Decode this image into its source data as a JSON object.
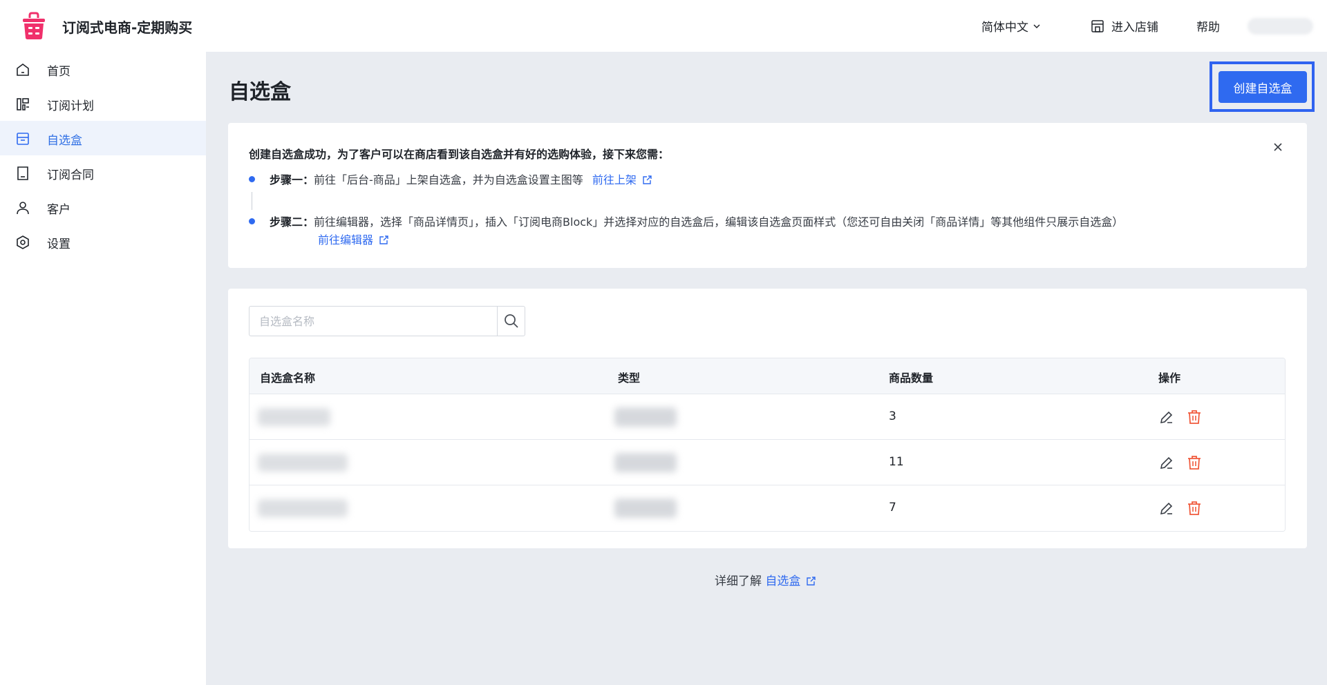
{
  "header": {
    "app_title": "订阅式电商-定期购买",
    "language": "简体中文",
    "enter_store": "进入店铺",
    "help": "帮助",
    "icons": {
      "logo": "basket-logo-icon",
      "lang": "chevron-down-icon",
      "store": "store-icon"
    }
  },
  "sidebar": {
    "items": [
      {
        "label": "首页",
        "icon": "home-icon",
        "active": false
      },
      {
        "label": "订阅计划",
        "icon": "layout-icon",
        "active": false
      },
      {
        "label": "自选盒",
        "icon": "box-icon",
        "active": true
      },
      {
        "label": "订阅合同",
        "icon": "document-icon",
        "active": false
      },
      {
        "label": "客户",
        "icon": "user-icon",
        "active": false
      },
      {
        "label": "设置",
        "icon": "settings-hexagon-icon",
        "active": false
      }
    ]
  },
  "page": {
    "title": "自选盒",
    "create_button": "创建自选盒"
  },
  "notice": {
    "title": "创建自选盒成功，为了客户可以在商店看到该自选盒并有好的选购体验，接下来您需：",
    "step1_prefix": "步骤一：",
    "step1_text": "前往「后台-商品」上架自选盒，并为自选盒设置主图等",
    "step1_link": "前往上架",
    "step2_prefix": "步骤二：",
    "step2_text": "前往编辑器，选择「商品详情页」，插入「订阅电商Block」并选择对应的自选盒后，编辑该自选盒页面样式（您还可自由关闭「商品详情」等其他组件只展示自选盒）",
    "step2_link": "前往编辑器"
  },
  "search": {
    "placeholder": "自选盒名称",
    "value": ""
  },
  "table": {
    "columns": [
      "自选盒名称",
      "类型",
      "商品数量",
      "操作"
    ],
    "rows": [
      {
        "count": "3"
      },
      {
        "count": "11"
      },
      {
        "count": "7"
      }
    ]
  },
  "footer": {
    "prefix": "详细了解",
    "link": "自选盒"
  },
  "colors": {
    "accent": "#2f6af0",
    "delete": "#f05a3c",
    "sidebar_active_bg": "#eef3fc",
    "page_bg": "#e9ecf1"
  }
}
